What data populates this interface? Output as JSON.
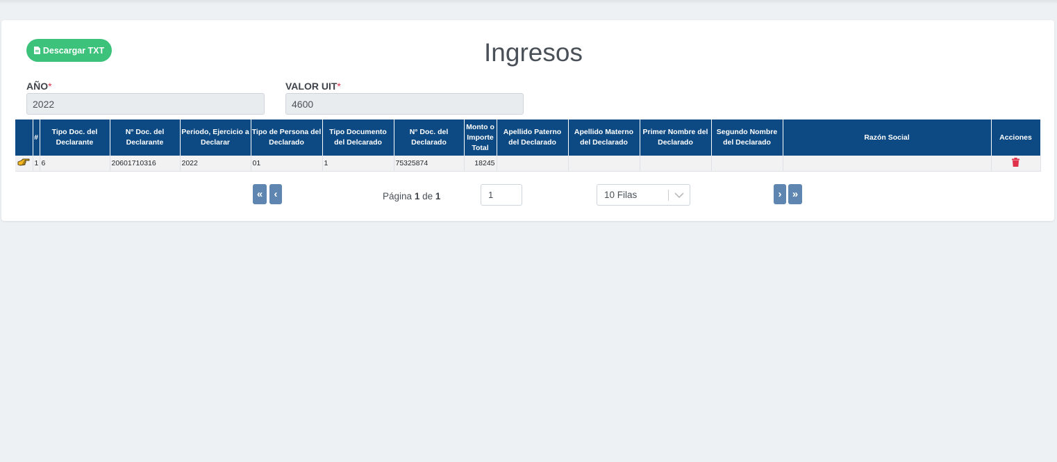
{
  "header": {
    "download_label": "Descargar TXT",
    "title": "Ingresos"
  },
  "fields": {
    "anio": {
      "label": "AÑO",
      "required_mark": "*",
      "value": "2022"
    },
    "uit": {
      "label": "VALOR UIT",
      "required_mark": "*",
      "value": "4600"
    }
  },
  "table": {
    "columns": [
      "",
      "#",
      "Tipo Doc. del Declarante",
      "N° Doc. del Declarante",
      "Periodo, Ejercicio a Declarar",
      "Tipo de Persona del Declarado",
      "Tipo Documento del Delcarado",
      "N° Doc. del Declarado",
      "Monto o Importe Total",
      "Apellido Paterno del Declarado",
      "Apellido Materno del Declarado",
      "Primer Nombre del Declarado",
      "Segundo Nombre del Declarado",
      "Razón Social",
      "Acciones"
    ],
    "rows": [
      {
        "index": "1",
        "tipo_doc_declarante": "6",
        "num_doc_declarante": "20601710316",
        "periodo": "2022",
        "tipo_persona": "01",
        "tipo_documento": "1",
        "num_doc_declarado": "75325874",
        "monto": "18245",
        "apellido_paterno": "",
        "apellido_materno": "",
        "primer_nombre": "",
        "segundo_nombre": "",
        "razon_social": ""
      }
    ]
  },
  "pagination": {
    "first_label": "«",
    "prev_label": "‹",
    "next_label": "›",
    "last_label": "»",
    "page_word": "Página",
    "current_page": "1",
    "of_word": "de",
    "total_pages": "1",
    "goto_value": "1",
    "rows_option": "10 Filas"
  },
  "colors": {
    "accent_green": "#3cc27a",
    "header_blue": "#0d4a83",
    "pager_blue": "#5e86b0",
    "delete_red": "#e0314b"
  },
  "icons": {
    "download": "file-icon",
    "row_pointer": "hand-pointer-icon",
    "delete": "trash-icon",
    "select": "chevron-down-icon"
  }
}
